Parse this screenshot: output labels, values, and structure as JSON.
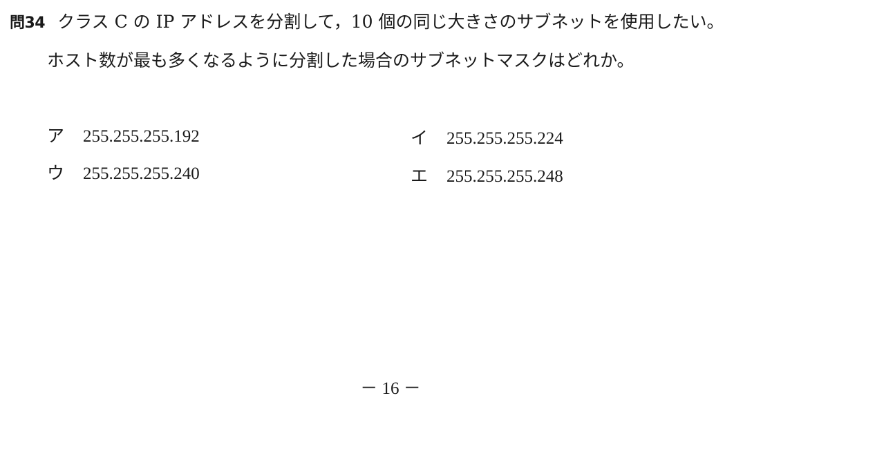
{
  "question": {
    "number": "問34",
    "line1": "クラス C の IP アドレスを分割して，10 個の同じ大きさのサブネットを使用したい。",
    "line2": "ホスト数が最も多くなるように分割した場合のサブネットマスクはどれか。"
  },
  "options": [
    {
      "label": "ア",
      "value": "255.255.255.192"
    },
    {
      "label": "イ",
      "value": "255.255.255.224"
    },
    {
      "label": "ウ",
      "value": "255.255.255.240"
    },
    {
      "label": "エ",
      "value": "255.255.255.248"
    }
  ],
  "footer": {
    "page_number": "－ 16 －"
  }
}
